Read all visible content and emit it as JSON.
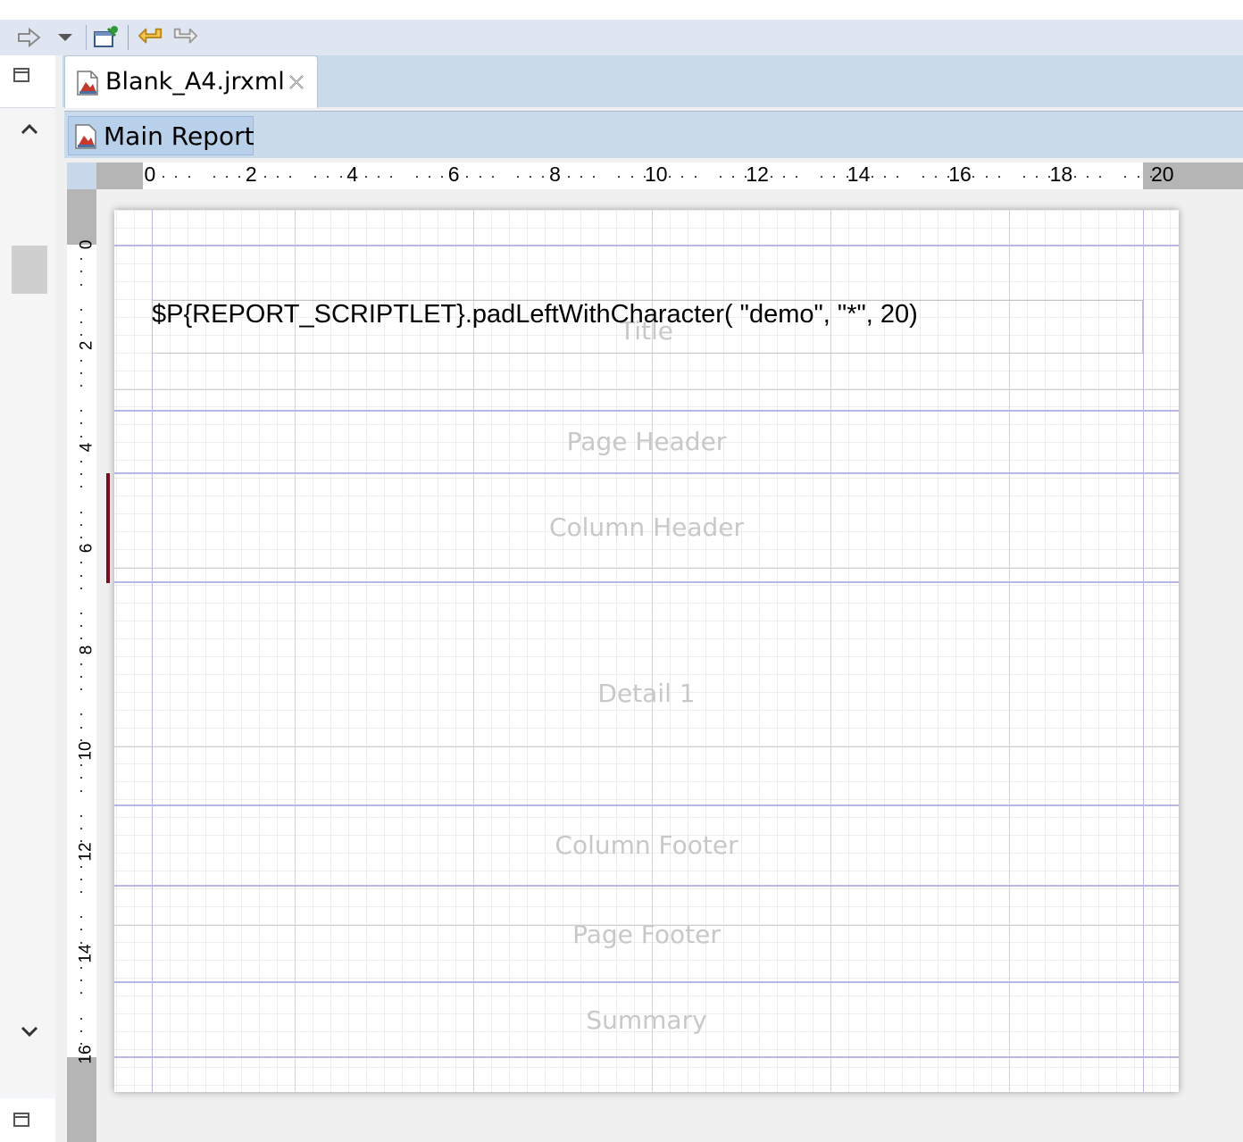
{
  "toolbar": {
    "buttons": [
      "forward-arrow-icon",
      "dropdown-icon",
      "new-report-icon",
      "undo-icon",
      "redo-icon"
    ]
  },
  "editor_tab": {
    "label": "Blank_A4.jrxml",
    "icon": "jrxml-file-icon",
    "close_icon": "close-icon"
  },
  "breadcrumb": {
    "label": "Main Report"
  },
  "ruler": {
    "horizontal": [
      "0",
      "2",
      "4",
      "6",
      "8",
      "10",
      "12",
      "14",
      "16",
      "18",
      "20"
    ],
    "vertical": [
      "0",
      "2",
      "4",
      "6",
      "8",
      "10",
      "12",
      "14",
      "16"
    ]
  },
  "report": {
    "bands": {
      "title": "Title",
      "page_header": "Page Header",
      "column_header": "Column Header",
      "detail": "Detail 1",
      "column_footer": "Column Footer",
      "page_footer": "Page Footer",
      "summary": "Summary"
    },
    "text_field": {
      "expression": "$P{REPORT_SCRIPTLET}.padLeftWithCharacter( \"demo\", \"*\", 20)"
    }
  },
  "colors": {
    "band_line": "#b8b8e6",
    "selection_marker": "#7a0f22",
    "tab_bar": "#c9daea"
  }
}
